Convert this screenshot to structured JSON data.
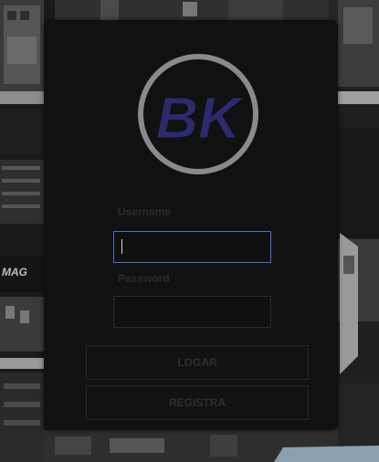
{
  "brand": {
    "logo_text": "BK",
    "primary_color": "#2b2b6e",
    "ring_color": "#8a8a8a"
  },
  "form": {
    "username_label": "Username",
    "username_value": "",
    "password_label": "Password",
    "password_value": "",
    "login_button": "LOGAR",
    "register_button": "REGISTRA"
  },
  "background": {
    "board_text": "MAG"
  }
}
